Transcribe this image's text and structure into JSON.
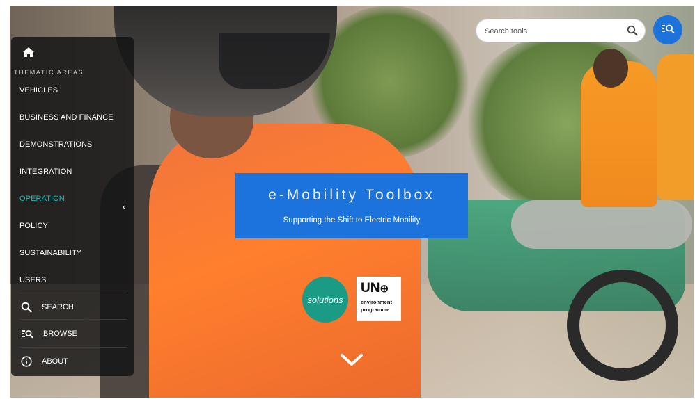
{
  "app": {
    "title": "e-Mobility Toolbox",
    "subtitle": "Supporting the Shift to Electric Mobility",
    "accent": "#1c73db",
    "active_color": "#21b9b1"
  },
  "search": {
    "placeholder": "Search tools",
    "value": ""
  },
  "sidebar": {
    "section_label": "THEMATIC AREAS",
    "items": [
      {
        "label": "VEHICLES",
        "active": false
      },
      {
        "label": "BUSINESS AND FINANCE",
        "active": false
      },
      {
        "label": "DEMONSTRATIONS",
        "active": false
      },
      {
        "label": "INTEGRATION",
        "active": false
      },
      {
        "label": "OPERATION",
        "active": true
      },
      {
        "label": "POLICY",
        "active": false
      },
      {
        "label": "SUSTAINABILITY",
        "active": false
      },
      {
        "label": "USERS",
        "active": false
      }
    ],
    "actions": [
      {
        "label": "SEARCH",
        "icon": "search-icon"
      },
      {
        "label": "BROWSE",
        "icon": "browse-icon"
      },
      {
        "label": "ABOUT",
        "icon": "info-icon"
      }
    ]
  },
  "logos": {
    "solutions": "solutions",
    "solutions_sub": "plus",
    "unep_top": "UN",
    "unep_line1": "environment",
    "unep_line2": "programme"
  }
}
